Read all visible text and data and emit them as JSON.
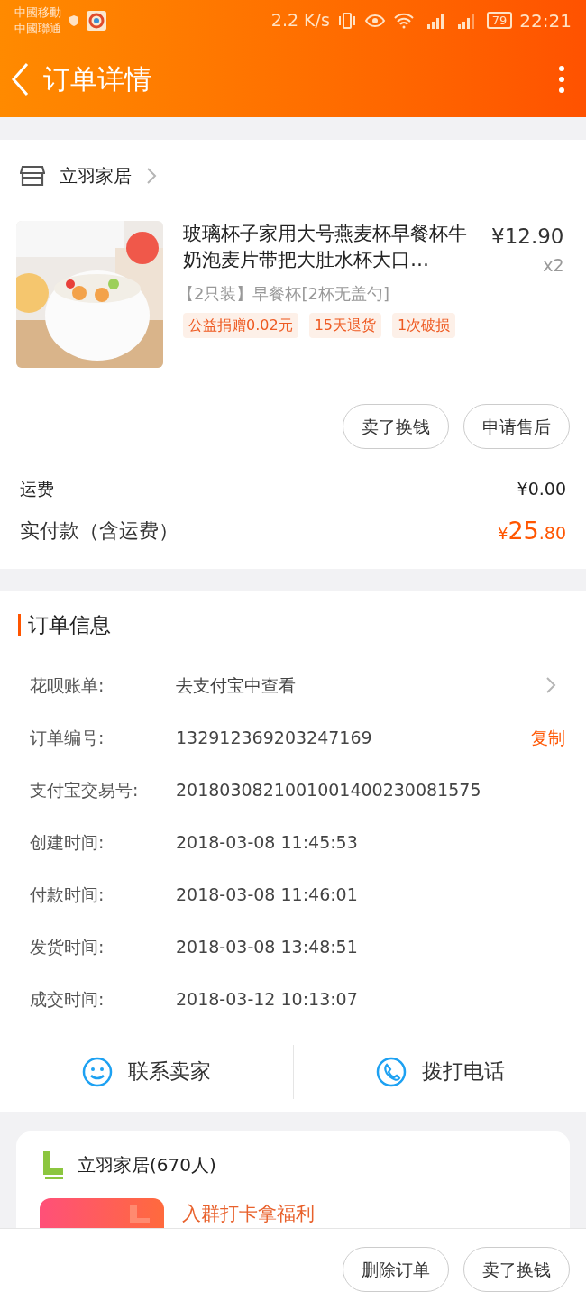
{
  "status_bar": {
    "carriers": [
      "中國移動",
      "中國聯通"
    ],
    "speed": "2.2 K/s",
    "battery": "79",
    "time": "22:21"
  },
  "header": {
    "title": "订单详情"
  },
  "shop": {
    "name": "立羽家居"
  },
  "product": {
    "title": "玻璃杯子家用大号燕麦杯早餐杯牛奶泡麦片带把大肚水杯大口…",
    "price": "¥12.90",
    "quantity": "x2",
    "variant": "【2只装】早餐杯[2杯无盖勺]",
    "tags": [
      "公益捐赠0.02元",
      "15天退货",
      "1次破损"
    ],
    "actions": [
      "卖了换钱",
      "申请售后"
    ]
  },
  "totals": [
    {
      "kind": "shipping",
      "label": "运费",
      "value": "¥0.00"
    },
    {
      "kind": "paid",
      "label": "实付款（含运费）",
      "currency": "¥",
      "integer": "25",
      "decimal": ".80"
    }
  ],
  "order_info": {
    "title": "订单信息",
    "rows": [
      {
        "kind": "link",
        "label": "花呗账单:",
        "value": "去支付宝中查看"
      },
      {
        "kind": "copy",
        "label": "订单编号:",
        "value": "132912369203247169",
        "action": "复制"
      },
      {
        "kind": "plain",
        "label": "支付宝交易号:",
        "value": "2018030821001001400230081575"
      },
      {
        "kind": "plain",
        "label": "创建时间:",
        "value": "2018-03-08 11:45:53"
      },
      {
        "kind": "plain",
        "label": "付款时间:",
        "value": "2018-03-08 11:46:01"
      },
      {
        "kind": "plain",
        "label": "发货时间:",
        "value": "2018-03-08 13:48:51"
      },
      {
        "kind": "plain",
        "label": "成交时间:",
        "value": "2018-03-12 10:13:07"
      }
    ]
  },
  "contact": [
    {
      "kind": "chat",
      "label": "联系卖家"
    },
    {
      "kind": "phone",
      "label": "拨打电话"
    }
  ],
  "group": {
    "name": "立羽家居(670人)",
    "promo_title": "入群打卡拿福利"
  },
  "bottom_actions": [
    "删除订单",
    "卖了换钱"
  ]
}
